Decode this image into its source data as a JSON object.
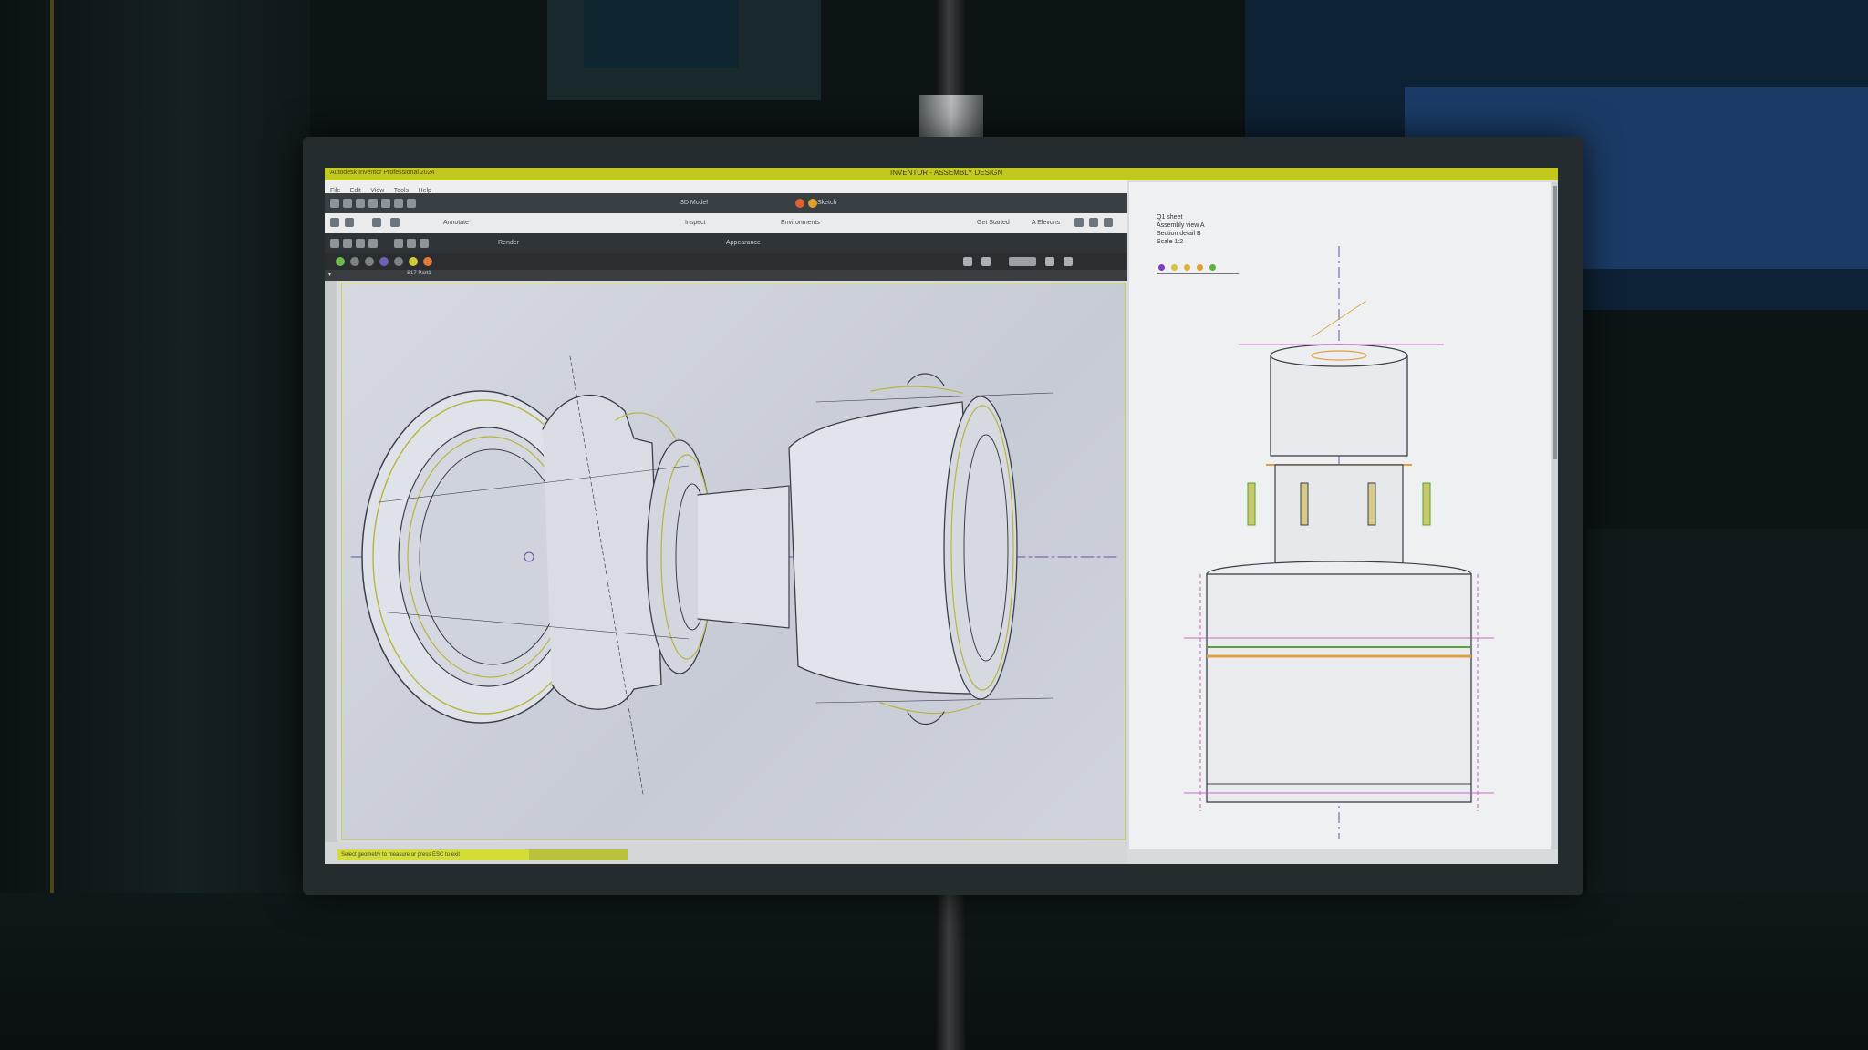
{
  "window": {
    "title": "INVENTOR - ASSEMBLY DESIGN",
    "left_title": "Autodesk Inventor Professional 2024"
  },
  "menu": {
    "items": [
      "File",
      "Edit",
      "View",
      "Tools",
      "Help"
    ]
  },
  "toolbar": {
    "group_a": "3D Model",
    "group_b": "Sketch",
    "group_c": "Annotate",
    "inspect": "Inspect",
    "environment": "Environments",
    "view_label": "Get Started",
    "autolimit": "A Elevons",
    "render": "Render",
    "appearance": "Appearance",
    "part_name": "S17 Part1"
  },
  "status": {
    "message": "Select geometry to measure or press ESC to exit"
  },
  "drawing_panel": {
    "heading": "Q1 sheet",
    "line1": "Assembly view A",
    "line2": "Section detail B",
    "line3": "Scale 1:2"
  },
  "colors": {
    "accent": "#c3c81d",
    "highlight": "#d4dc38",
    "edge_yellow": "#b8b440",
    "edge_dark": "#3b3f4a",
    "centerline": "#6a4fb0",
    "dimension": "#c040b0",
    "hidden_orange": "#e0a040",
    "green_line": "#5aa03a"
  },
  "swatches": [
    "#7a3fc0",
    "#d8c040",
    "#e0b030",
    "#e0a030",
    "#60b040"
  ]
}
